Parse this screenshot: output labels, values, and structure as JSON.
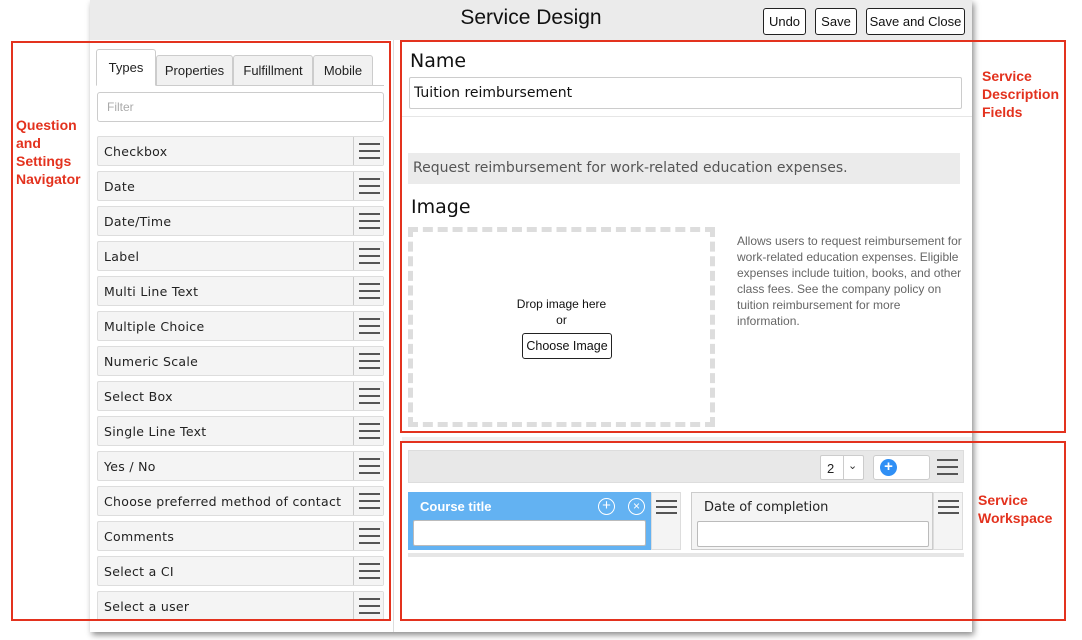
{
  "header": {
    "title": "Service Design",
    "undo_label": "Undo",
    "save_label": "Save",
    "save_close_label": "Save and Close"
  },
  "tabs": [
    {
      "label": "Types",
      "active": true
    },
    {
      "label": "Properties",
      "active": false
    },
    {
      "label": "Fulfillment",
      "active": false
    },
    {
      "label": "Mobile",
      "active": false
    }
  ],
  "filter": {
    "placeholder": "Filter"
  },
  "types": [
    "Checkbox",
    "Date",
    "Date/Time",
    "Label",
    "Multi Line Text",
    "Multiple Choice",
    "Numeric Scale",
    "Select Box",
    "Single Line Text",
    "Yes / No",
    "Choose preferred method of contact",
    "Comments",
    "Select a CI",
    "Select a user"
  ],
  "service": {
    "name_label": "Name",
    "name_value": "Tuition reimbursement",
    "short_description": "Request reimbursement for work-related education expenses.",
    "image_label": "Image",
    "drop_text": "Drop image here",
    "or_text": "or",
    "choose_image_label": "Choose Image",
    "description": "Allows users to request reimbursement for work-related education expenses. Eligible expenses include tuition, books, and other class fees. See the company policy on tuition reimbursement for more information."
  },
  "workspace": {
    "columns_value": "2",
    "questions": [
      {
        "title": "Course title",
        "selected": true
      },
      {
        "title": "Date of completion",
        "selected": false
      }
    ]
  },
  "callouts": {
    "navigator": "Question and Settings Navigator",
    "description_fields": "Service Description Fields",
    "workspace": "Service Workspace"
  },
  "colors": {
    "accent_blue": "#2f8ff5",
    "selected_card": "#63b2f2",
    "callout_red": "#e3321e",
    "header_bg": "#ebebeb"
  }
}
